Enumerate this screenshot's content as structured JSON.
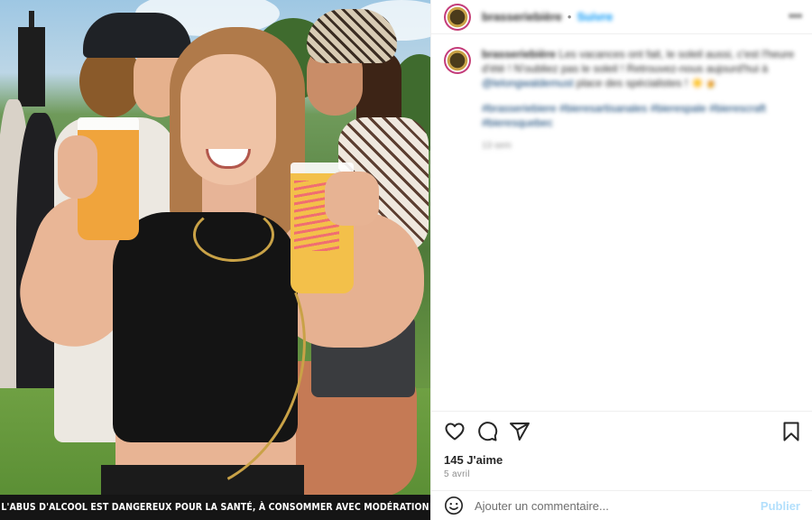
{
  "post": {
    "image": {
      "alt_subject": "festival-photo",
      "warning_text": "L'abus d'alcool est dangereux pour la santé, à consommer avec modération"
    },
    "header": {
      "username": "brasseriebière",
      "dot": "•",
      "follow_label": "Suivre",
      "more_label": "•••"
    },
    "caption": {
      "username": "brasseriebière",
      "text": " Les vacances ont fait, le soleil aussi, c'est l'heure d'été ! N'oubliez pas le soleil ! Retrouvez-nous aujourd'hui à ",
      "mention": "@lelongwaldemust",
      "text_after": " place des spécialistes ! ☀️🍺",
      "hashtags": "#brasseriebiere #bieresartisanales #bierespale #bierescraft #bieresquebec",
      "time": "13 sem"
    },
    "actions": {
      "like_icon": "heart-icon",
      "comment_icon": "comment-icon",
      "share_icon": "share-icon",
      "save_icon": "bookmark-icon"
    },
    "likes": "145 J'aime",
    "date": "5 avril",
    "comment": {
      "placeholder": "Ajouter un commentaire...",
      "publish_label": "Publier",
      "emoji_icon": "emoji-icon"
    }
  },
  "colors": {
    "link_blue": "#0095f6",
    "publish_disabled": "#b2dffc",
    "text_primary": "#262626",
    "text_secondary": "#8e8e8e",
    "warning_bar": "#151515"
  }
}
